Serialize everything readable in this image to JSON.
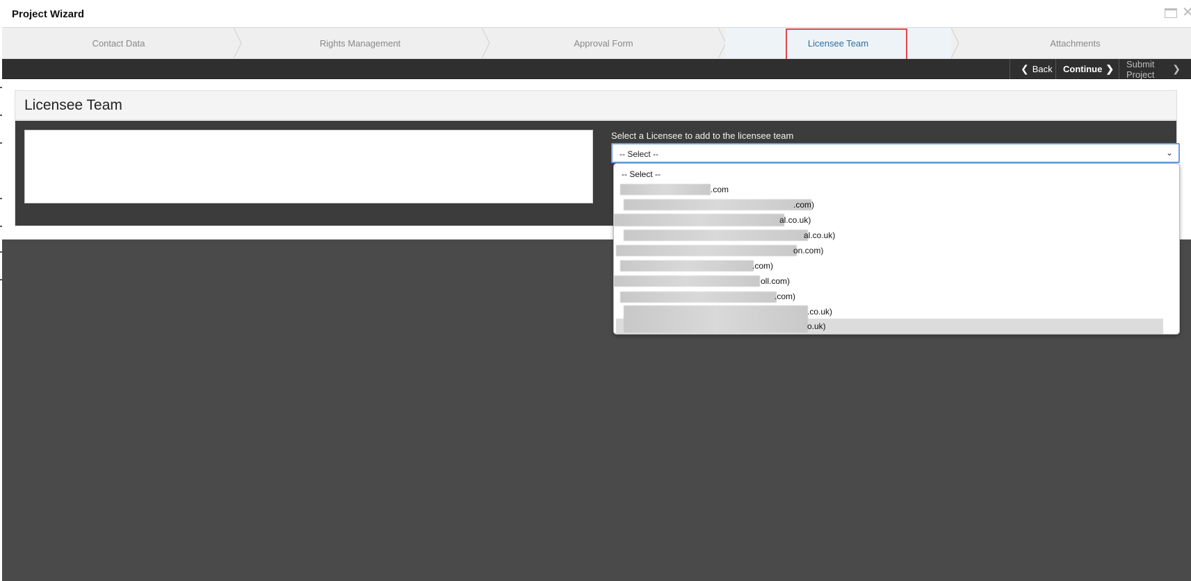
{
  "window": {
    "title": "Project Wizard"
  },
  "steps": [
    {
      "label": "Contact Data"
    },
    {
      "label": "Rights Management"
    },
    {
      "label": "Approval Form"
    },
    {
      "label": "Licensee Team",
      "active": true
    },
    {
      "label": "Attachments"
    }
  ],
  "toolbar": {
    "back": "Back",
    "continue": "Continue",
    "submit": "Submit Project"
  },
  "card": {
    "title": "Licensee Team"
  },
  "licensee_select": {
    "label": "Select a Licensee to add to the licensee team",
    "selected": "-- Select --"
  },
  "dropdown_options": [
    "-- Select --",
    ".com",
    ".com)",
    "al.co.uk)",
    "al.co.uk)",
    "on.com)",
    ".com)",
    "oll.com)",
    ".com)",
    ".co.uk)",
    "o.uk)"
  ],
  "colors": {
    "active_step_text": "#2e6f9e",
    "highlight": "#e0474c",
    "toolbar_bg": "#2f2f2f"
  }
}
